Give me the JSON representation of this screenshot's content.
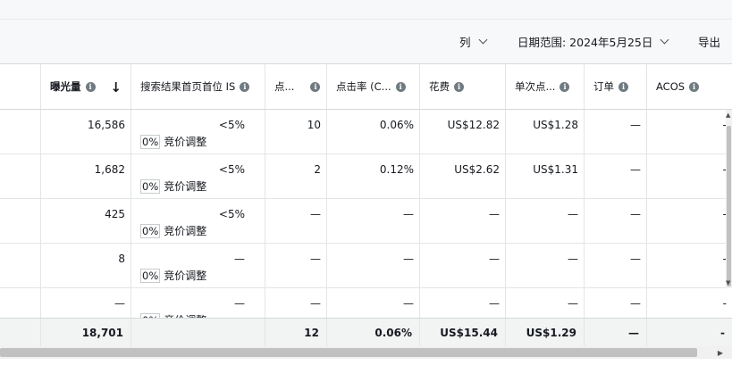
{
  "toolbar": {
    "columns_label": "列",
    "date_range_label": "日期范围: 2024年5月25日",
    "export_label": "导出"
  },
  "columns": [
    {
      "key": "impressions",
      "label": "曝光量",
      "bold": true,
      "sorted": "desc",
      "info_icon": true
    },
    {
      "key": "top_of_search_is",
      "label": "搜索结果首页首位 IS",
      "info_icon": true
    },
    {
      "key": "clicks",
      "label": "点...",
      "info_icon": true
    },
    {
      "key": "ctr",
      "label": "点击率 (C...",
      "info_icon": true
    },
    {
      "key": "spend",
      "label": "花费",
      "info_icon": true
    },
    {
      "key": "cpc",
      "label": "单次点...",
      "info_icon": true
    },
    {
      "key": "orders",
      "label": "订单",
      "info_icon": true
    },
    {
      "key": "acos",
      "label": "ACOS",
      "info_icon": true
    }
  ],
  "rows": [
    {
      "impressions": "16,586",
      "top_of_search_is": "<5%",
      "bid_pct": "0%",
      "bid_label": "竞价调整",
      "clicks": "10",
      "ctr": "0.06%",
      "spend": "US$12.82",
      "cpc": "US$1.28",
      "orders": "—",
      "acos": "-"
    },
    {
      "impressions": "1,682",
      "top_of_search_is": "<5%",
      "bid_pct": "0%",
      "bid_label": "竞价调整",
      "clicks": "2",
      "ctr": "0.12%",
      "spend": "US$2.62",
      "cpc": "US$1.31",
      "orders": "—",
      "acos": "-"
    },
    {
      "impressions": "425",
      "top_of_search_is": "<5%",
      "bid_pct": "0%",
      "bid_label": "竞价调整",
      "clicks": "—",
      "ctr": "—",
      "spend": "—",
      "cpc": "—",
      "orders": "—",
      "acos": "-"
    },
    {
      "impressions": "8",
      "top_of_search_is": "—",
      "bid_pct": "0%",
      "bid_label": "竞价调整",
      "clicks": "—",
      "ctr": "—",
      "spend": "—",
      "cpc": "—",
      "orders": "—",
      "acos": "-"
    },
    {
      "impressions": "—",
      "top_of_search_is": "—",
      "bid_pct": "0%",
      "bid_label": "竞价调整",
      "clicks": "—",
      "ctr": "—",
      "spend": "—",
      "cpc": "—",
      "orders": "—",
      "acos": "-"
    }
  ],
  "totals": {
    "impressions": "18,701",
    "top_of_search_is": "",
    "clicks": "12",
    "ctr": "0.06%",
    "spend": "US$15.44",
    "cpc": "US$1.29",
    "orders": "—",
    "acos": "-"
  },
  "icons": {
    "info": "info-icon",
    "sort": "sort-desc-arrow-icon",
    "dropdown": "chevron-down-icon"
  },
  "colors": {
    "toolbar_bg": "#f7f8f9",
    "total_row_bg": "#f2f3f3",
    "border": "#e3e6e6",
    "info_icon": "#6f7b80"
  }
}
